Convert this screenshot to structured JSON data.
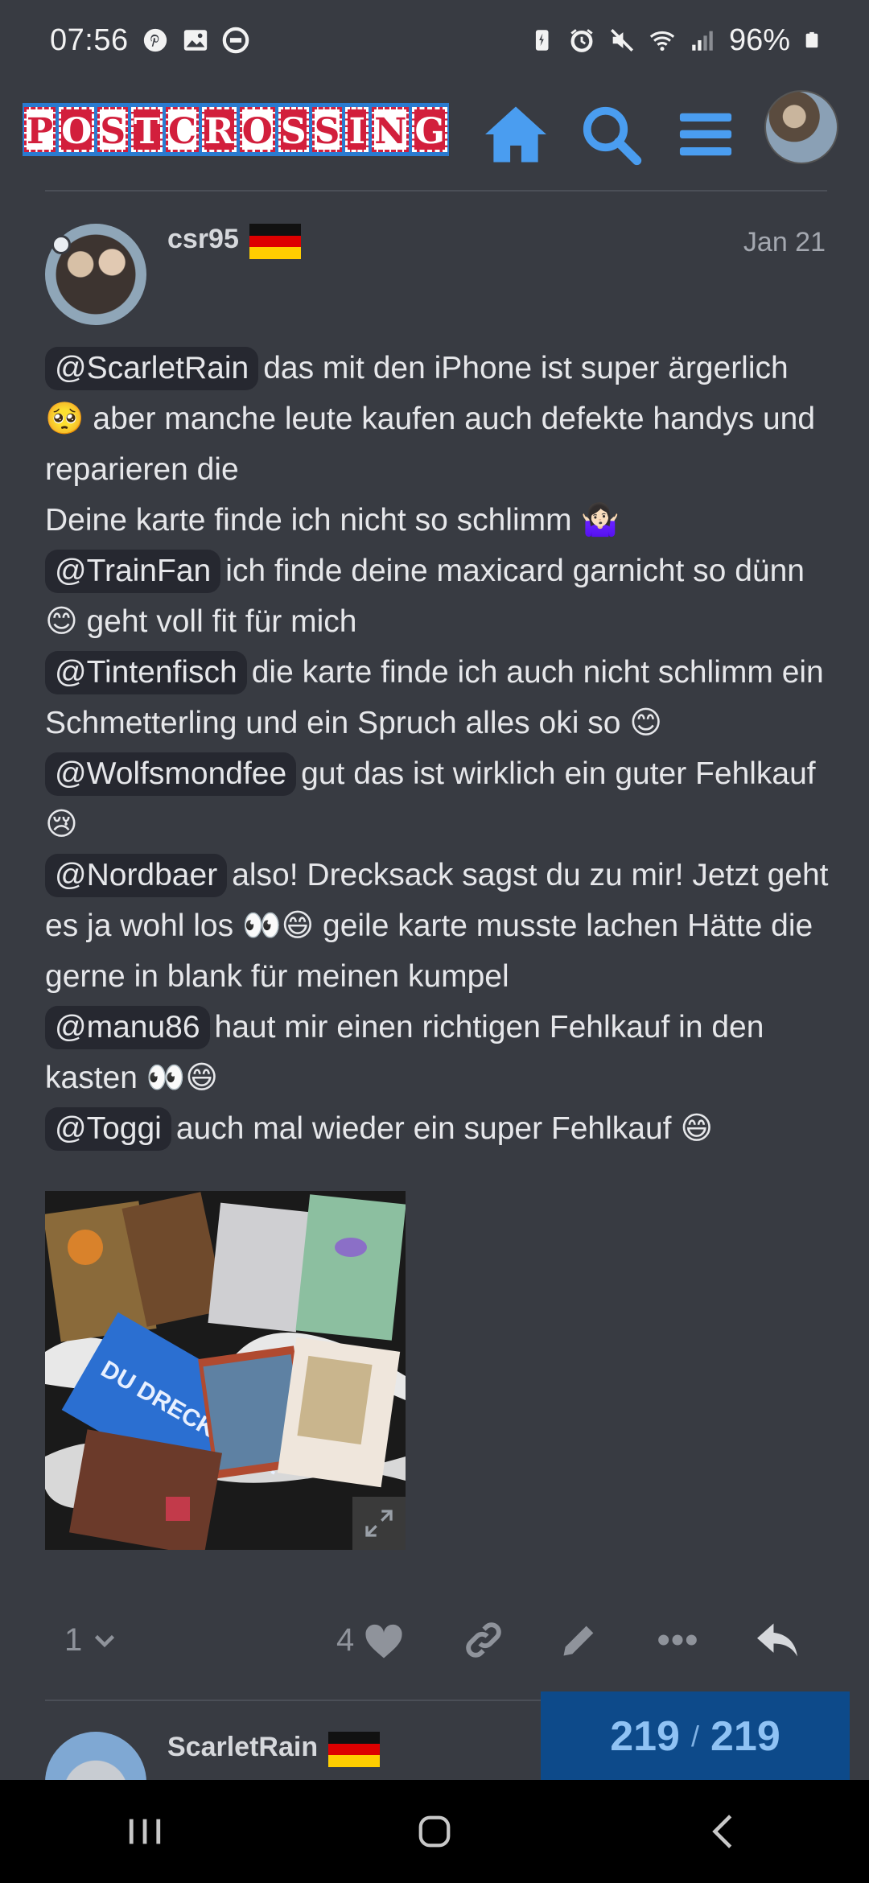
{
  "status_bar": {
    "time": "07:56",
    "battery_percent": "96%",
    "left_icons": [
      "pinterest-icon",
      "gallery-icon",
      "sync-icon"
    ],
    "right_icons": [
      "battery-saver-icon",
      "alarm-icon",
      "mute-icon",
      "wifi-icon",
      "signal-icon",
      "battery-icon"
    ]
  },
  "header": {
    "logo_letters": [
      "P",
      "O",
      "S",
      "T",
      "C",
      "R",
      "O",
      "S",
      "S",
      "I",
      "N",
      "G"
    ],
    "buttons": [
      "home-icon",
      "search-icon",
      "menu-icon"
    ],
    "accent": "#4a9df0"
  },
  "post": {
    "username": "csr95",
    "date": "Jan 21",
    "paragraphs": [
      {
        "mention": "@ScarletRain",
        "text": "das mit den iPhone ist super ärgerlich 🥺 aber manche leute kaufen auch defekte handys und reparieren die"
      },
      {
        "mention": "",
        "text": "Deine karte finde ich nicht so schlimm 🤷🏻‍♀️"
      },
      {
        "mention": "@TrainFan",
        "text": "ich finde deine maxicard garnicht so dünn 😊 geht voll fit für mich"
      },
      {
        "mention": "@Tintenfisch",
        "text": "die karte finde ich auch nicht schlimm ein Schmetterling und ein Spruch alles oki so 😊"
      },
      {
        "mention": "@Wolfsmondfee",
        "text": "gut das ist wirklich ein guter Fehlkauf 😢"
      },
      {
        "mention": "@Nordbaer",
        "text": "also! Drecksack sagst du zu mir! Jetzt geht es ja wohl los 👀😄 geile karte musste lachen Hätte die gerne in blank für meinen kumpel"
      },
      {
        "mention": "@manu86",
        "text": "haut mir einen richtigen Fehlkauf in den kasten 👀😄"
      },
      {
        "mention": "@Toggi",
        "text": "auch mal wieder ein super Fehlkauf 😄"
      }
    ],
    "image_text": "DU DRECKSACK!",
    "reply_count": "1",
    "like_count": "4"
  },
  "next_post": {
    "username": "ScarletRain"
  },
  "progress": {
    "current": "219",
    "separator": "/",
    "total": "219"
  }
}
